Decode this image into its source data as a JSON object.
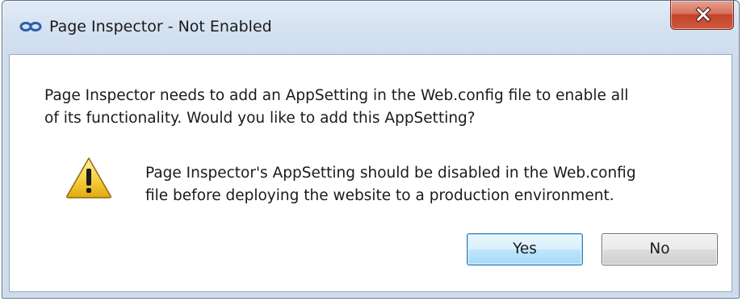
{
  "window": {
    "title": "Page Inspector - Not Enabled",
    "app_icon": "infinity-link-icon",
    "close_icon": "close-x-icon"
  },
  "message": {
    "line1": "Page Inspector needs to add an AppSetting in the Web.config file to enable all",
    "line2": "of its functionality. Would you like to add this AppSetting?"
  },
  "warning": {
    "icon": "warning-triangle-icon",
    "line1": "Page Inspector's AppSetting should be disabled in the Web.config",
    "line2": "file before deploying the website to a production environment."
  },
  "buttons": {
    "yes_label": "Yes",
    "no_label": "No"
  },
  "colors": {
    "close_button": "#c7482f",
    "default_button_border": "#3c7fb1",
    "window_frame": "#d6e3f2"
  }
}
